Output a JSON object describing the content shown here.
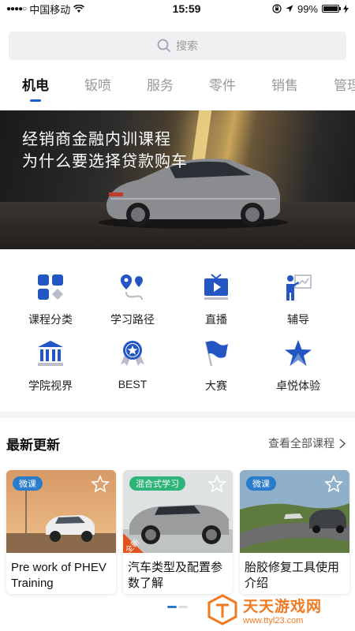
{
  "status_bar": {
    "carrier": "中国移动",
    "time": "15:59",
    "battery_percent": "99%",
    "battery_level": 0.99
  },
  "search": {
    "placeholder": "搜索",
    "icon": "search-icon"
  },
  "tabs": [
    {
      "label": "机电",
      "active": true
    },
    {
      "label": "钣喷",
      "active": false
    },
    {
      "label": "服务",
      "active": false
    },
    {
      "label": "零件",
      "active": false
    },
    {
      "label": "销售",
      "active": false
    },
    {
      "label": "管理",
      "active": false
    }
  ],
  "banner": {
    "line1": "经销商金融内训课程",
    "line2": "为什么要选择贷款购车"
  },
  "menu": [
    {
      "label": "课程分类",
      "icon": "grid-categories-icon"
    },
    {
      "label": "学习路径",
      "icon": "route-pin-icon"
    },
    {
      "label": "直播",
      "icon": "live-tv-icon"
    },
    {
      "label": "辅导",
      "icon": "teacher-board-icon"
    },
    {
      "label": "学院视界",
      "icon": "academy-building-icon"
    },
    {
      "label": "BEST",
      "icon": "award-ribbon-icon"
    },
    {
      "label": "大赛",
      "icon": "flag-icon"
    },
    {
      "label": "卓悦体验",
      "icon": "star-peak-icon"
    }
  ],
  "latest": {
    "title": "最新更新",
    "view_all": "查看全部课程",
    "cards": [
      {
        "badge": "微课",
        "title": "Pre work of PHEV Training"
      },
      {
        "badge": "混合式学习",
        "corner_tag": "全新",
        "title": "汽车类型及配置参数了解"
      },
      {
        "badge": "微课",
        "title": "胎胶修复工具使用介绍"
      }
    ]
  },
  "watermark": {
    "brand": "天天游戏网",
    "url": "www.ttyl23.com"
  },
  "colors": {
    "accent": "#1c5bd6",
    "icon_blue": "#2356c2",
    "badge_blue": "#2a7ccb",
    "badge_green": "#2eb37a",
    "watermark": "#f07a22"
  }
}
